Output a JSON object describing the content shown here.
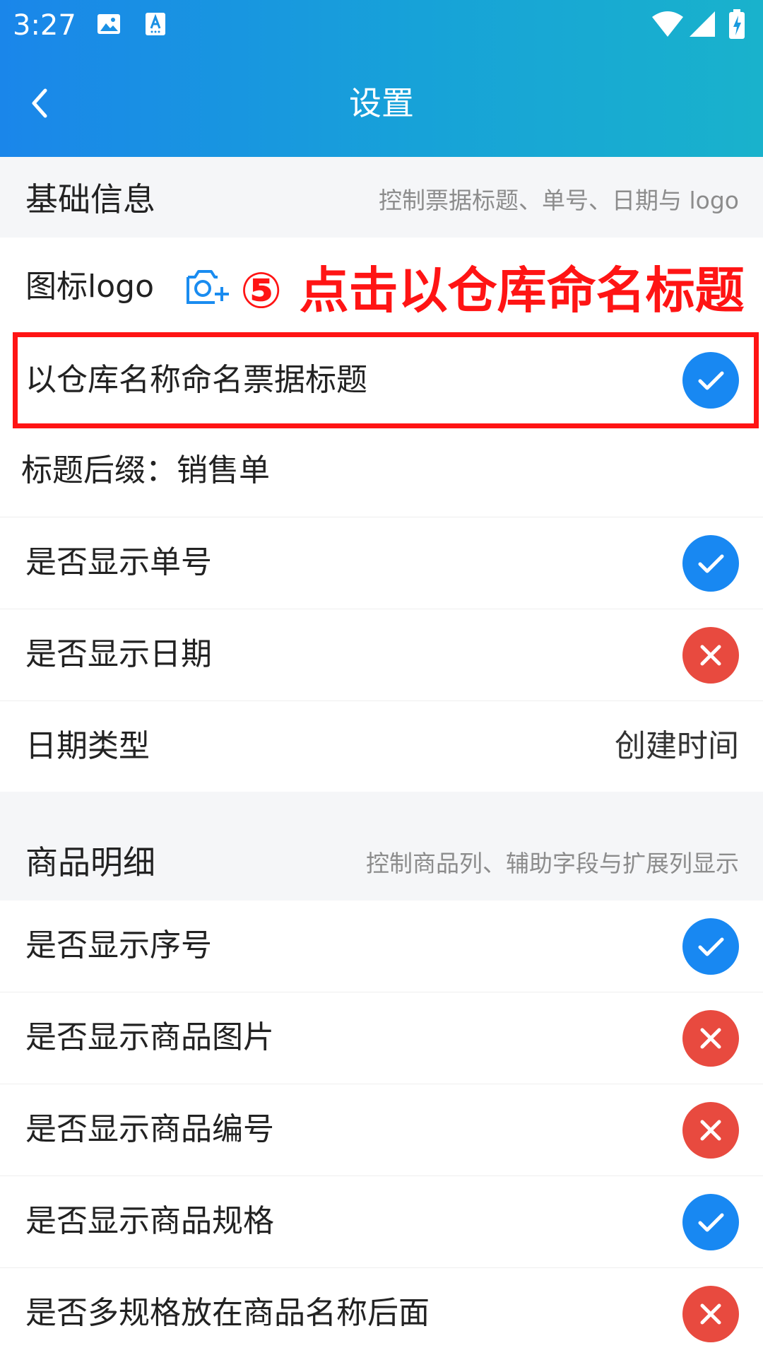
{
  "status_bar": {
    "time": "3:27"
  },
  "header": {
    "title": "设置"
  },
  "sections": {
    "basic": {
      "title": "基础信息",
      "desc": "控制票据标题、单号、日期与 logo"
    },
    "goods": {
      "title": "商品明细",
      "desc": "控制商品列、辅助字段与扩展列显示"
    }
  },
  "logo_row": {
    "label": "图标logo"
  },
  "annotation": {
    "text": "⑤ 点击以仓库命名标题"
  },
  "rows": {
    "warehouse_title": {
      "label": "以仓库名称命名票据标题",
      "checked": true
    },
    "title_suffix": {
      "label": "标题后缀：销售单"
    },
    "show_number": {
      "label": "是否显示单号",
      "checked": true
    },
    "show_date": {
      "label": "是否显示日期",
      "checked": false
    },
    "date_type": {
      "label": "日期类型",
      "value": "创建时间"
    },
    "show_seq": {
      "label": "是否显示序号",
      "checked": true
    },
    "show_image": {
      "label": "是否显示商品图片",
      "checked": false
    },
    "show_code": {
      "label": "是否显示商品编号",
      "checked": false
    },
    "show_spec": {
      "label": "是否显示商品规格",
      "checked": true
    },
    "multi_spec_after_name": {
      "label": "是否多规格放在商品名称后面",
      "checked": false
    }
  },
  "colors": {
    "accent": "#1888f2",
    "off": "#e84a3f",
    "annotation": "#ff1414"
  }
}
